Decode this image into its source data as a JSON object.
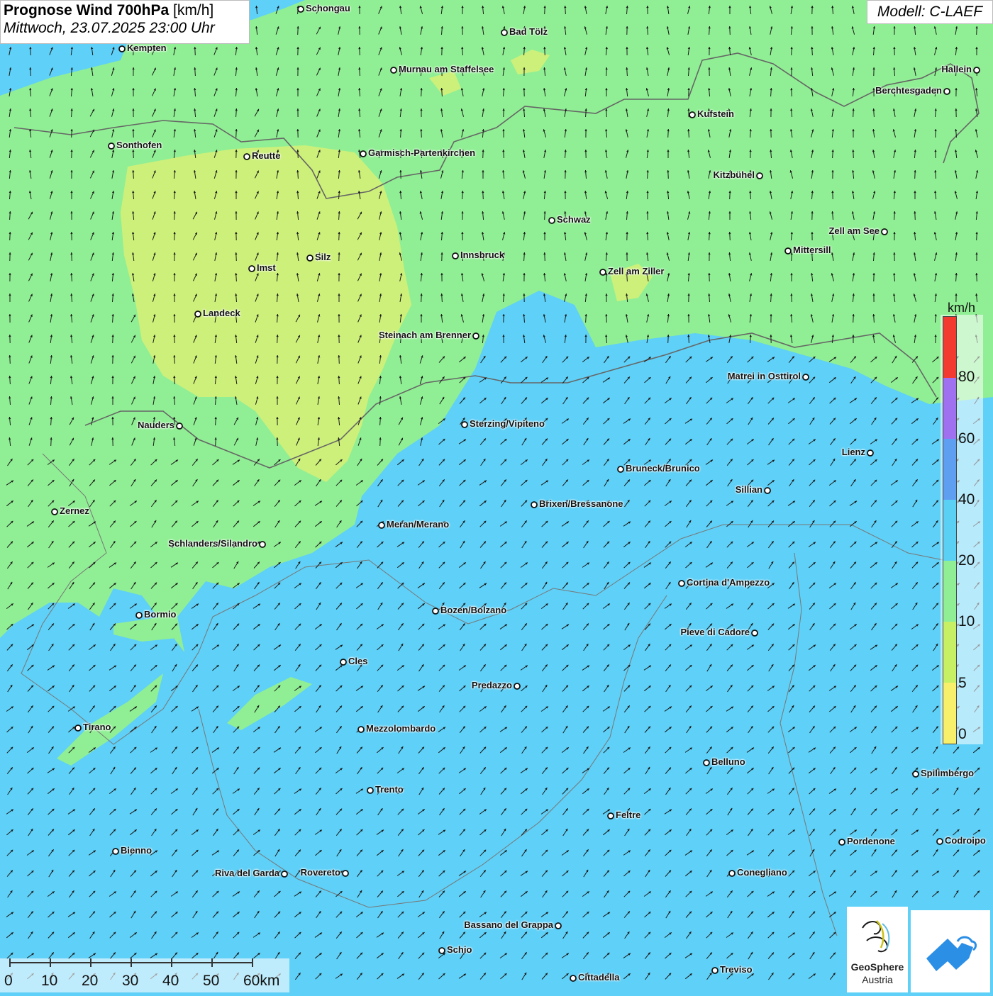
{
  "header": {
    "title_bold": "Prognose Wind 700hPa",
    "title_unit": "[km/h]",
    "datetime": "Mittwoch, 23.07.2025 23:00 Uhr",
    "model": "Modell: C-LAEF"
  },
  "legend": {
    "unit": "km/h",
    "labels": [
      "0",
      "5",
      "10",
      "20",
      "40",
      "60",
      "80"
    ],
    "colors": [
      "#f8f06a",
      "#c8f064",
      "#90ef94",
      "#5bd0f5",
      "#5f9ff2",
      "#9f70ef",
      "#f23a30"
    ]
  },
  "colors": {
    "zone_lt10": "#90ef94",
    "zone_lt5": "#cdf07a",
    "zone_ge10": "#5fd0f7",
    "arrow": "#1a1a1a",
    "border": "#666666"
  },
  "cities": [
    {
      "name": "Schongau"
    },
    {
      "name": "Bad Tölz"
    },
    {
      "name": "Kempten"
    },
    {
      "name": "Murnau am Staffelsee"
    },
    {
      "name": "Hallein"
    },
    {
      "name": "Berchtesgaden"
    },
    {
      "name": "Kufstein"
    },
    {
      "name": "Sonthofen"
    },
    {
      "name": "Reutte"
    },
    {
      "name": "Garmisch-Partenkirchen"
    },
    {
      "name": "Kitzbühel"
    },
    {
      "name": "Schwaz"
    },
    {
      "name": "Zell am See"
    },
    {
      "name": "Mittersill"
    },
    {
      "name": "Silz"
    },
    {
      "name": "Innsbruck"
    },
    {
      "name": "Imst"
    },
    {
      "name": "Zell am Ziller"
    },
    {
      "name": "Landeck"
    },
    {
      "name": "Steinach am Brenner"
    },
    {
      "name": "Matrei in Osttirol"
    },
    {
      "name": "Nauders"
    },
    {
      "name": "Sterzing/Vipiteno"
    },
    {
      "name": "Lienz"
    },
    {
      "name": "Bruneck/Brunico"
    },
    {
      "name": "Sillian"
    },
    {
      "name": "Brixen/Bressanone"
    },
    {
      "name": "Zernez"
    },
    {
      "name": "Meran/Merano"
    },
    {
      "name": "Schlanders/Silandro"
    },
    {
      "name": "Cortina d'Ampezzo"
    },
    {
      "name": "Bozen/Bolzano"
    },
    {
      "name": "Bormio"
    },
    {
      "name": "Pieve di Cadore"
    },
    {
      "name": "Cles"
    },
    {
      "name": "Predazzo"
    },
    {
      "name": "Tirano"
    },
    {
      "name": "Mezzolombardo"
    },
    {
      "name": "Belluno"
    },
    {
      "name": "Spilimbergo"
    },
    {
      "name": "Trento"
    },
    {
      "name": "Feltre"
    },
    {
      "name": "Pordenone"
    },
    {
      "name": "Codroipo"
    },
    {
      "name": "Bienno"
    },
    {
      "name": "Riva del Garda"
    },
    {
      "name": "Rovereto"
    },
    {
      "name": "Conegliano"
    },
    {
      "name": "Bassano del Grappa"
    },
    {
      "name": "Schio"
    },
    {
      "name": "Treviso"
    },
    {
      "name": "Cittadella"
    }
  ],
  "scale": {
    "labels": [
      "0",
      "10",
      "20",
      "30",
      "40",
      "50",
      "60km"
    ]
  },
  "logo": {
    "name": "GeoSphere",
    "sub": "Austria"
  }
}
